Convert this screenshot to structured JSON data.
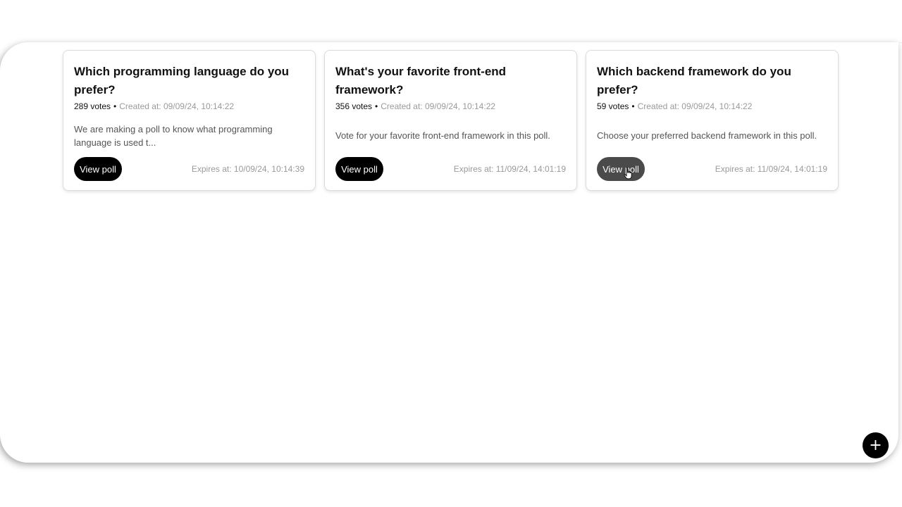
{
  "polls": [
    {
      "title": "Which programming language do you prefer?",
      "votes": "289 votes",
      "separator": "•",
      "created": "Created at: 09/09/24, 10:14:22",
      "description": "We are making a poll to know what programming language is used t...",
      "button_label": "View poll",
      "expires": "Expires at: 10/09/24, 10:14:39"
    },
    {
      "title": "What's your favorite front-end framework?",
      "votes": "356 votes",
      "separator": "•",
      "created": "Created at: 09/09/24, 10:14:22",
      "description": "Vote for your favorite front-end framework in this poll.",
      "button_label": "View poll",
      "expires": "Expires at: 11/09/24, 14:01:19"
    },
    {
      "title": "Which backend framework do you prefer?",
      "votes": "59 votes",
      "separator": "•",
      "created": "Created at: 09/09/24, 10:14:22",
      "description": "Choose your preferred backend framework in this poll.",
      "button_label": "View poll",
      "expires": "Expires at: 11/09/24, 14:01:19"
    }
  ],
  "fab": {
    "label": "+",
    "icon": "plus-icon"
  },
  "colors": {
    "button": "#000000",
    "button_hover": "#4a4a4a",
    "muted_text": "#9a9a9a"
  }
}
